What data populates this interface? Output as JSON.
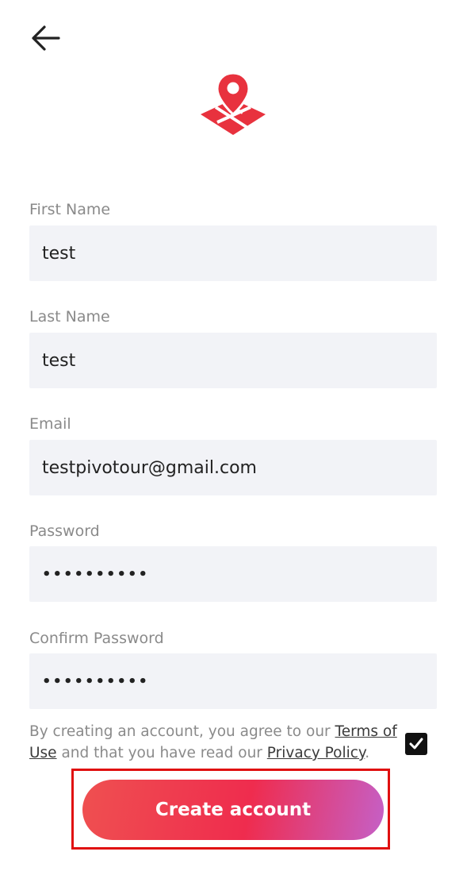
{
  "nav": {
    "back_icon": "arrow-left-icon"
  },
  "logo": {
    "icon": "map-pin-logo",
    "color": "#e8323e"
  },
  "form": {
    "first_name": {
      "label": "First Name",
      "value": "test"
    },
    "last_name": {
      "label": "Last Name",
      "value": "test"
    },
    "email": {
      "label": "Email",
      "value": "testpivotour@gmail.com"
    },
    "password": {
      "label": "Password",
      "value": "••••••••••"
    },
    "confirm_password": {
      "label": "Confirm Password",
      "value": "••••••••••"
    }
  },
  "terms": {
    "prefix": "By creating an account, you agree to our ",
    "terms_link": "Terms of Use",
    "middle": " and that you have read our ",
    "privacy_link": "Privacy Policy",
    "suffix": ".",
    "checked": true
  },
  "create_button": {
    "label": "Create account"
  },
  "colors": {
    "field_bg": "#f2f3f7",
    "label": "#8a8a8a",
    "accent": "#ef2c4e",
    "highlight": "#e01010"
  }
}
